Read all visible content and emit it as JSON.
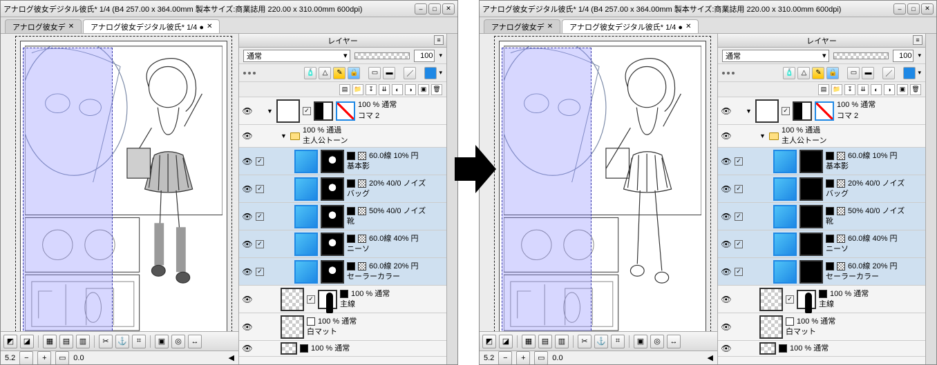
{
  "title": "アナログ彼女デジタル彼氏* 1/4 (B4 257.00 x 364.00mm 製本サイズ:商業誌用 220.00 x 310.00mm 600dpi)",
  "tabs": {
    "inactive": "アナログ彼女デ",
    "active": "アナログ彼女デジタル彼氏* 1/4 ●"
  },
  "panel": {
    "title": "レイヤー"
  },
  "blend": {
    "mode": "通常",
    "opacity": "100"
  },
  "zoom": {
    "value": "5.2",
    "angle": "0.0"
  },
  "layers": {
    "koma": {
      "info": "100 % 通常",
      "name": "コマ 2"
    },
    "folder": {
      "info": "100 % 通過",
      "name": "主人公トーン"
    },
    "l1": {
      "info": "60.0線 10% 円",
      "name": "基本影"
    },
    "l2": {
      "info": "20% 40/0 ノイズ",
      "name": "バッグ"
    },
    "l3": {
      "info": "50% 40/0 ノイズ",
      "name": "靴"
    },
    "l4": {
      "info": "60.0線 40% 円",
      "name": "ニーソ"
    },
    "l5": {
      "info": "60.0線 20% 円",
      "name": "セーラーカラー"
    },
    "sen": {
      "info": "100 % 通常",
      "name": "主線"
    },
    "mat": {
      "info": "100 % 通常",
      "name": "白マット"
    },
    "last": {
      "info": "100 % 通常"
    }
  }
}
